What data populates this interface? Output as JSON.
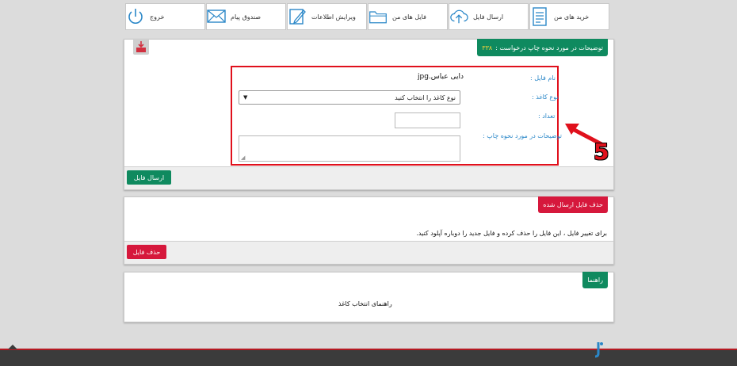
{
  "nav": {
    "items": [
      {
        "label": "خرید های من",
        "icon": "document-list-icon"
      },
      {
        "label": "ارسال فایل",
        "icon": "cloud-upload-icon"
      },
      {
        "label": "فایل های من",
        "icon": "folder-icon"
      },
      {
        "label": "ویرایش اطلاعات",
        "icon": "edit-icon"
      },
      {
        "label": "صندوق پیام",
        "icon": "envelope-icon"
      },
      {
        "label": "خروج",
        "icon": "power-icon"
      }
    ]
  },
  "print_panel": {
    "tab_title": "توضیحات در مورد نحوه چاپ درخواست :",
    "request_number": "۳۳۸",
    "file_name_label": "نام فایل :",
    "file_name_value": "دایی عباس.jpg",
    "paper_type_label": "نوع کاغذ :",
    "paper_type_selected": "نوع کاغذ را انتخاب کنید",
    "count_label": "تعداد :",
    "count_value": "",
    "notes_label": "توضیحات در مورد نحوه چاپ :",
    "notes_value": "",
    "submit_label": "ارسال فایل",
    "annotation_number": "5"
  },
  "delete_panel": {
    "tab_title": "حذف فایل ارسال شده",
    "message": "برای تغییر فایل ، این فایل را حذف کرده و فایل جدید را دوباره آپلود کنید.",
    "delete_label": "حذف فایل"
  },
  "guide_panel": {
    "tab_title": "راهنما",
    "link_text": "راهنمای انتخاب کاغذ"
  },
  "colors": {
    "accent_green": "#0f8a5f",
    "accent_red": "#d6183c",
    "annotation_red": "#e0101c",
    "label_blue": "#2a87c8"
  }
}
